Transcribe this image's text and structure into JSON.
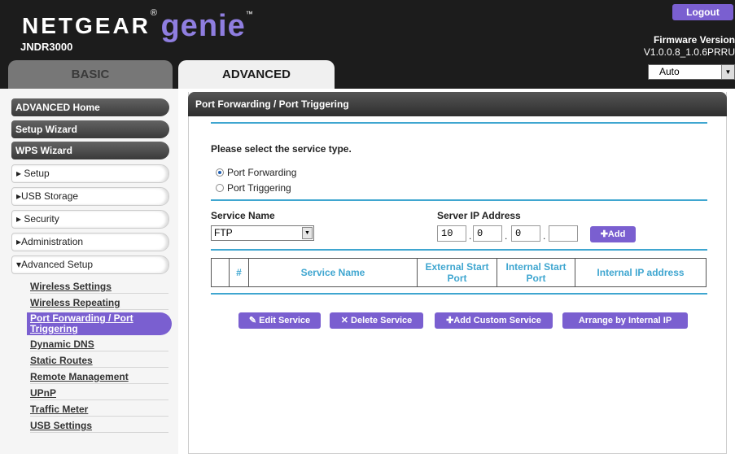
{
  "header": {
    "brand": "NETGEAR",
    "product": "genie",
    "model": "JNDR3000",
    "logout_label": "Logout",
    "firmware_label": "Firmware Version",
    "firmware_value": "V1.0.0.8_1.0.6PRRU",
    "tabs": [
      {
        "label": "BASIC",
        "active": false
      },
      {
        "label": "ADVANCED",
        "active": true
      }
    ],
    "language_select": {
      "value": "Auto"
    }
  },
  "sidebar": {
    "primary": [
      "ADVANCED Home",
      "Setup Wizard",
      "WPS Wizard"
    ],
    "sections": [
      {
        "label": "Setup",
        "expanded": false
      },
      {
        "label": "USB Storage",
        "expanded": false
      },
      {
        "label": "Security",
        "expanded": false
      },
      {
        "label": "Administration",
        "expanded": false
      },
      {
        "label": "Advanced Setup",
        "expanded": true
      }
    ],
    "subitems": [
      "Wireless Settings",
      "Wireless Repeating",
      "Port Forwarding / Port Triggering",
      "Dynamic DNS",
      "Static Routes",
      "Remote Management",
      "UPnP",
      "Traffic Meter",
      "USB Settings"
    ],
    "active_subitem_index": 2
  },
  "main": {
    "title": "Port Forwarding / Port Triggering",
    "prompt": "Please select the service type.",
    "service_types": [
      {
        "label": "Port Forwarding",
        "selected": true
      },
      {
        "label": "Port Triggering",
        "selected": false
      }
    ],
    "service_name_label": "Service Name",
    "service_name_value": "FTP",
    "server_ip_label": "Server IP Address",
    "server_ip": [
      "10",
      "0",
      "0",
      ""
    ],
    "add_label": "Add",
    "table_headers": [
      "",
      "#",
      "Service Name",
      "External Start Port",
      "Internal Start Port",
      "Internal IP address"
    ],
    "actions": [
      "Edit Service",
      "Delete Service",
      "Add Custom Service",
      "Arrange by Internal IP"
    ]
  },
  "colors": {
    "accent": "#7a5fd0",
    "rule": "#3fa6d0",
    "header_bg": "#1c1c1c"
  }
}
